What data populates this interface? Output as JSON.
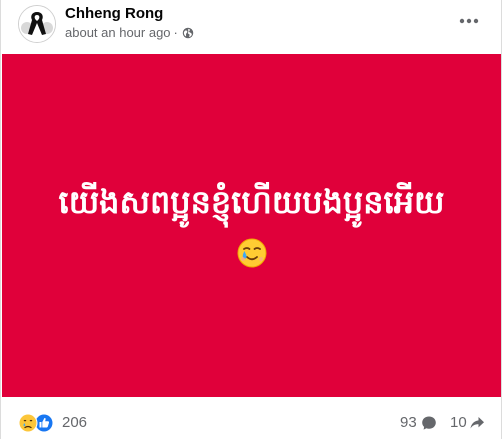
{
  "post": {
    "author": "Chheng Rong",
    "timestamp": "about an hour ago",
    "meta_separator": "·",
    "privacy_icon": "globe-icon",
    "more_icon": "more-options-icon",
    "image": {
      "background_color": "#e0003a",
      "text": "យើងសពប្អូនខ្ញុំហើយបងប្អូនអើយ",
      "emoji": "crying-face-emoji"
    },
    "reactions": {
      "icons": [
        "sad-reaction-icon",
        "like-reaction-icon"
      ],
      "count": "206"
    },
    "comments": {
      "count": "93",
      "icon": "comment-icon"
    },
    "shares": {
      "count": "10",
      "icon": "share-icon"
    }
  },
  "colors": {
    "post_background": "#e0003a",
    "text_secondary": "#65676b",
    "text_primary": "#050505",
    "like_blue": "#1877f2"
  }
}
